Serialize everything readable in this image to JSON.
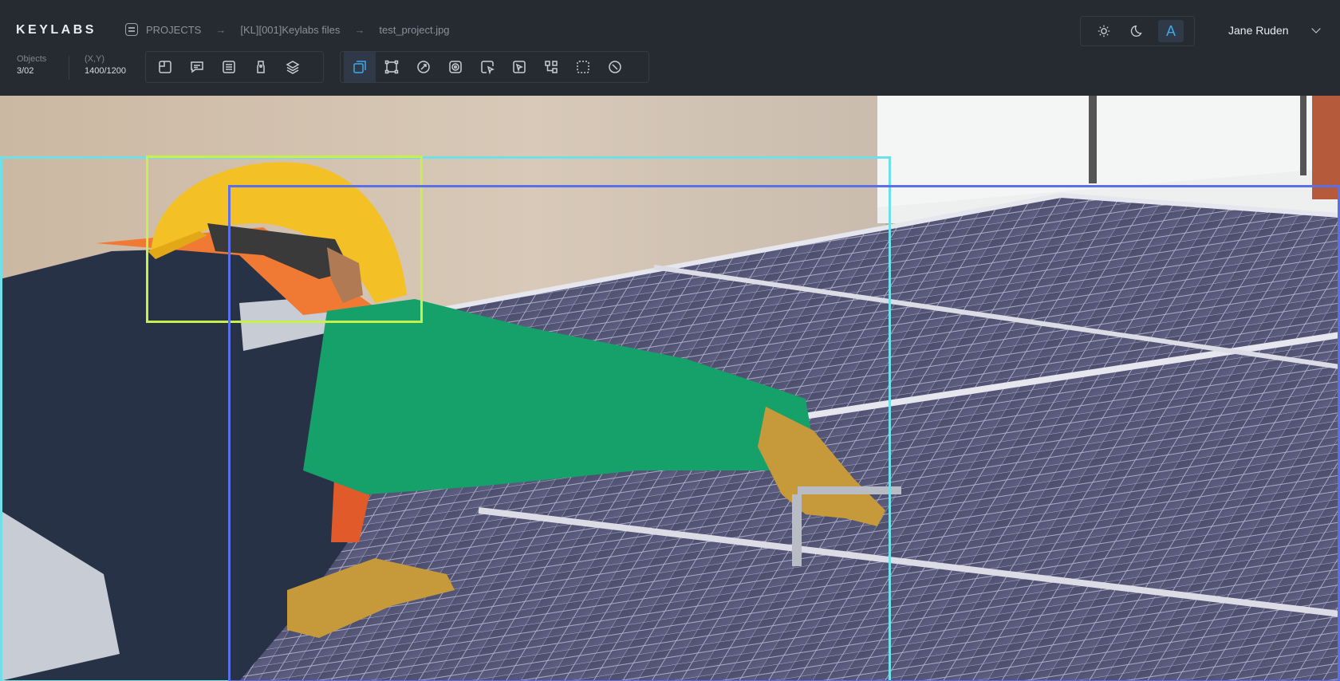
{
  "app": {
    "logo": "KEYLABS"
  },
  "breadcrumb": {
    "icon": "document-list-icon",
    "items": [
      "PROJECTS",
      "[KL][001]Keylabs files",
      "test_project.jpg"
    ],
    "separator": "→"
  },
  "stats": {
    "objects": {
      "label": "Objects",
      "value": "3/02"
    },
    "coords": {
      "label": "(X,Y)",
      "value": "1400/1200"
    }
  },
  "tool_groups": {
    "left": [
      {
        "name": "frame-tool-icon"
      },
      {
        "name": "comment-tool-icon"
      },
      {
        "name": "list-tool-icon"
      },
      {
        "name": "tag-tool-icon"
      },
      {
        "name": "layers-tool-icon"
      }
    ],
    "right": [
      {
        "name": "bounding-box-tool-icon",
        "active": true
      },
      {
        "name": "polygon-tool-icon"
      },
      {
        "name": "circle-tool-icon"
      },
      {
        "name": "target-tool-icon"
      },
      {
        "name": "lasso-tool-icon"
      },
      {
        "name": "smart-select-tool-icon"
      },
      {
        "name": "keypoints-tool-icon"
      },
      {
        "name": "selection-tool-icon"
      },
      {
        "name": "disable-tool-icon"
      }
    ]
  },
  "theme_switch": {
    "options": [
      "sun-icon",
      "moon-icon",
      "auto-icon"
    ],
    "auto_label": "A",
    "active": "auto"
  },
  "user": {
    "name": "Jane Ruden"
  },
  "annotations": [
    {
      "name": "annotation-person",
      "color": "#6fe0e8"
    },
    {
      "name": "annotation-helmet",
      "color": "#c6f04a"
    },
    {
      "name": "annotation-solar-panel",
      "color": "#5b6fe6"
    }
  ],
  "colors": {
    "accent": "#3fa9e6",
    "topbar": "#262a31"
  }
}
